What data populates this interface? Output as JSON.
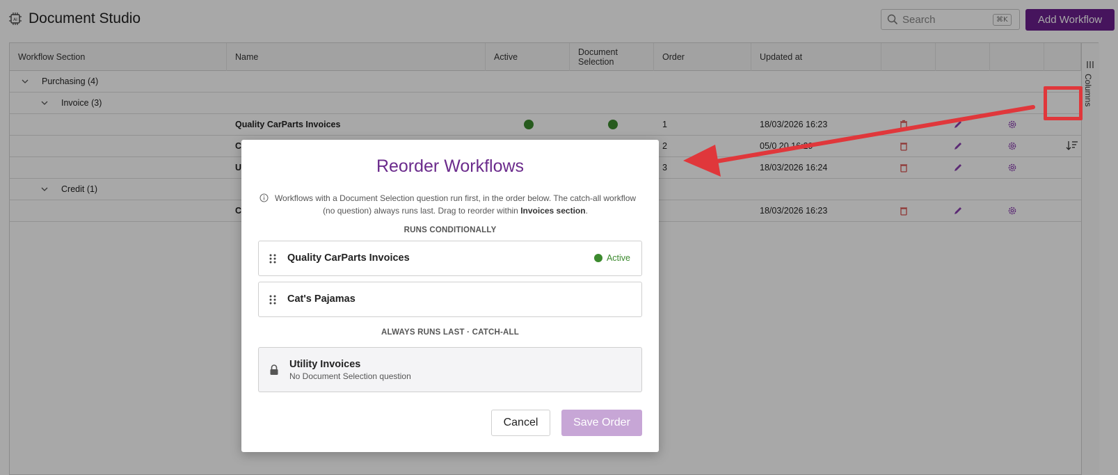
{
  "header": {
    "title": "Document Studio",
    "search_placeholder": "Search",
    "search_shortcut": "⌘K",
    "add_button": "Add Workflow"
  },
  "grid": {
    "columns": [
      "Workflow Section",
      "Name",
      "Active",
      "Document Selection",
      "Order",
      "Updated at"
    ],
    "side_panel_label": "Columns",
    "groups": {
      "purchasing": "Purchasing (4)",
      "invoice": "Invoice (3)",
      "credit": "Credit (1)"
    },
    "rows": [
      {
        "name": "Quality CarParts Invoices",
        "order": "1",
        "updated": "18/03/2026 16:23"
      },
      {
        "name": "C",
        "order": "2",
        "updated": "05/0  20 16:29"
      },
      {
        "name": "U",
        "order": "3",
        "updated": "18/03/2026 16:24"
      },
      {
        "name": "C",
        "order": "",
        "updated": "18/03/2026 16:23"
      }
    ]
  },
  "modal": {
    "title": "Reorder Workflows",
    "info_text_1": "Workflows with a Document Selection question run first, in the order below. The catch-all workflow (no question) always runs last. Drag to reorder within ",
    "info_text_bold": "Invoices section",
    "info_text_2": ".",
    "conditional_label": "RUNS CONDITIONALLY",
    "conditional_items": [
      {
        "name": "Quality CarParts Invoices",
        "status": "Active"
      },
      {
        "name": "Cat's Pajamas"
      }
    ],
    "catchall_label": "ALWAYS RUNS LAST · CATCH-ALL",
    "catchall_item": {
      "name": "Utility Invoices",
      "subtitle": "No Document Selection question"
    },
    "cancel_button": "Cancel",
    "save_button": "Save Order"
  },
  "colors": {
    "accent": "#6b1f8e",
    "active_green": "#3c8a2e",
    "delete_red": "#d9534f",
    "highlight_red": "#e0373b"
  }
}
